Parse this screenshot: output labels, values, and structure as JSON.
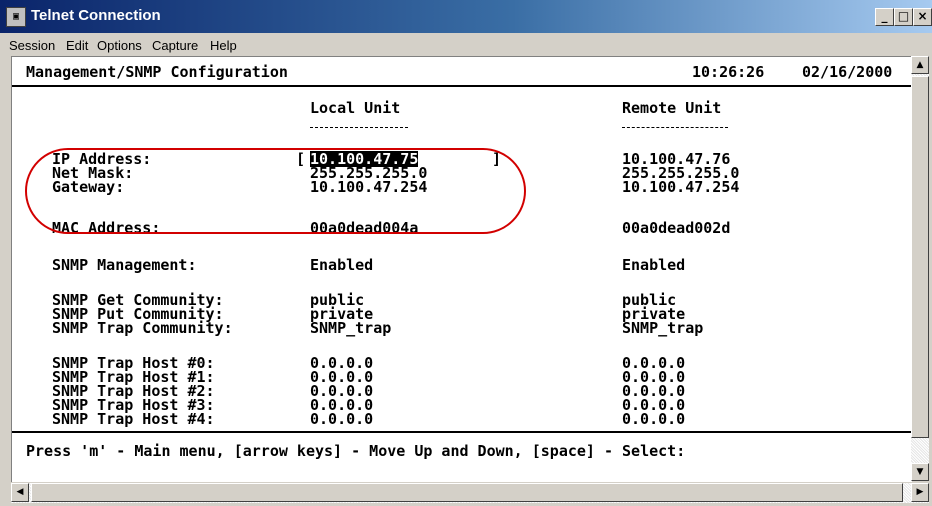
{
  "window": {
    "title": "Telnet Connection",
    "icon": "terminal-icon",
    "controls": {
      "minimize": "_",
      "maximize": "□",
      "close": "×"
    }
  },
  "menu": [
    "Session",
    "Edit",
    "Options",
    "Capture",
    "Help"
  ],
  "terminal": {
    "header_title": "Management/SNMP Configuration",
    "time": "10:26:26",
    "date": "02/16/2000",
    "col_local": "Local Unit",
    "col_remote": "Remote Unit",
    "rows": [
      {
        "label": "IP Address:",
        "local": "10.100.47.75",
        "remote": "10.100.47.76"
      },
      {
        "label": "Net Mask:",
        "local": "255.255.255.0",
        "remote": "255.255.255.0"
      },
      {
        "label": "Gateway:",
        "local": "10.100.47.254",
        "remote": "10.100.47.254"
      },
      {
        "label": "MAC Address:",
        "local": "00a0dead004a",
        "remote": "00a0dead002d"
      },
      {
        "label": "SNMP Management:",
        "local": "Enabled",
        "remote": "Enabled"
      },
      {
        "label": "SNMP Get Community:",
        "local": "public",
        "remote": "public"
      },
      {
        "label": "SNMP Put Community:",
        "local": "private",
        "remote": "private"
      },
      {
        "label": "SNMP Trap Community:",
        "local": "SNMP_trap",
        "remote": "SNMP_trap"
      },
      {
        "label": "SNMP Trap Host #0:",
        "local": "0.0.0.0",
        "remote": "0.0.0.0"
      },
      {
        "label": "SNMP Trap Host #1:",
        "local": "0.0.0.0",
        "remote": "0.0.0.0"
      },
      {
        "label": "SNMP Trap Host #2:",
        "local": "0.0.0.0",
        "remote": "0.0.0.0"
      },
      {
        "label": "SNMP Trap Host #3:",
        "local": "0.0.0.0",
        "remote": "0.0.0.0"
      },
      {
        "label": "SNMP Trap Host #4:",
        "local": "0.0.0.0",
        "remote": "0.0.0.0"
      }
    ],
    "edit_brackets": {
      "open": "[",
      "close": "]"
    },
    "prompt": "Press 'm' - Main menu, [arrow keys] - Move Up and Down, [space] - Select:"
  },
  "scroll": {
    "up": "▲",
    "down": "▼",
    "left": "◀",
    "right": "▶"
  },
  "colors": {
    "title_bar": "#0a246a",
    "annotation": "#d20000",
    "selection": "#000000"
  }
}
